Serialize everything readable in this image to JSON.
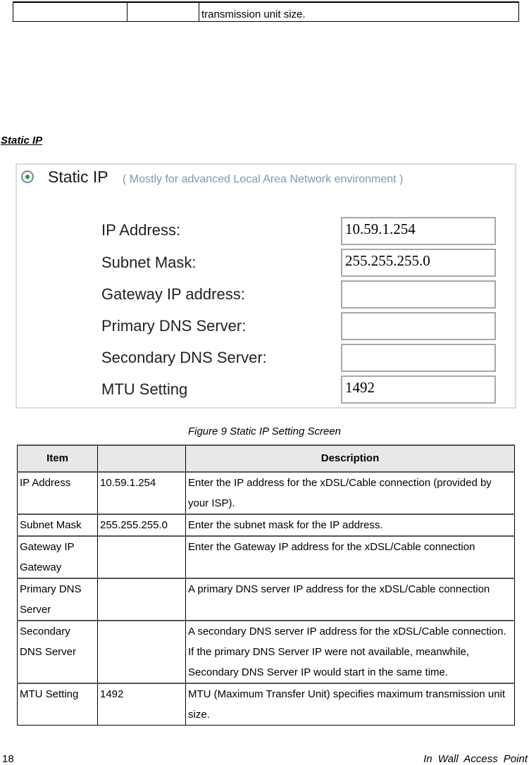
{
  "top_table": {
    "cells": [
      "",
      "",
      "transmission unit size."
    ]
  },
  "section_title": "Static IP",
  "screenshot": {
    "radio_selected": true,
    "title": "Static IP",
    "subtitle": "( Mostly for advanced Local Area Network environment )",
    "fields": [
      {
        "label": "IP Address:",
        "value": ""
      },
      {
        "label": "Subnet Mask:",
        "value": ""
      },
      {
        "label": "Gateway IP address:",
        "value": ""
      },
      {
        "label": "Primary DNS Server:",
        "value": ""
      },
      {
        "label": "Secondary DNS Server:",
        "value": ""
      },
      {
        "label": "MTU Setting",
        "value": ""
      }
    ],
    "values": {
      "ip": "10.59.1.254",
      "subnet": "255.255.255.0",
      "gateway": "",
      "dns1": "",
      "dns2": "",
      "mtu": "1492"
    }
  },
  "caption": "Figure 9 Static IP Setting Screen",
  "table": {
    "headers": [
      "Item",
      "",
      "Description"
    ],
    "rows": [
      {
        "item": "IP Address",
        "value": "10.59.1.254",
        "desc": "Enter the IP address for the xDSL/Cable connection (provided by your ISP)."
      },
      {
        "item": "Subnet Mask",
        "value": "255.255.255.0",
        "desc": "Enter the subnet mask for the IP address."
      },
      {
        "item": "Gateway IP Gateway",
        "value": "",
        "desc": "Enter the Gateway IP address for the xDSL/Cable connection"
      },
      {
        "item": "Primary DNS Server",
        "value": "",
        "desc": "A primary DNS server IP address for the xDSL/Cable connection"
      },
      {
        "item": "Secondary DNS Server",
        "value": "",
        "desc": "A secondary DNS server IP address for the xDSL/Cable connection. If the primary DNS Server IP were not available, meanwhile, Secondary DNS Server IP would start in the same time."
      },
      {
        "item": "MTU Setting",
        "value": "1492",
        "desc": "MTU (Maximum Transfer Unit) specifies maximum transmission unit size."
      }
    ]
  },
  "footer": {
    "page_number": "18",
    "doc_title": "In Wall Access Point"
  }
}
